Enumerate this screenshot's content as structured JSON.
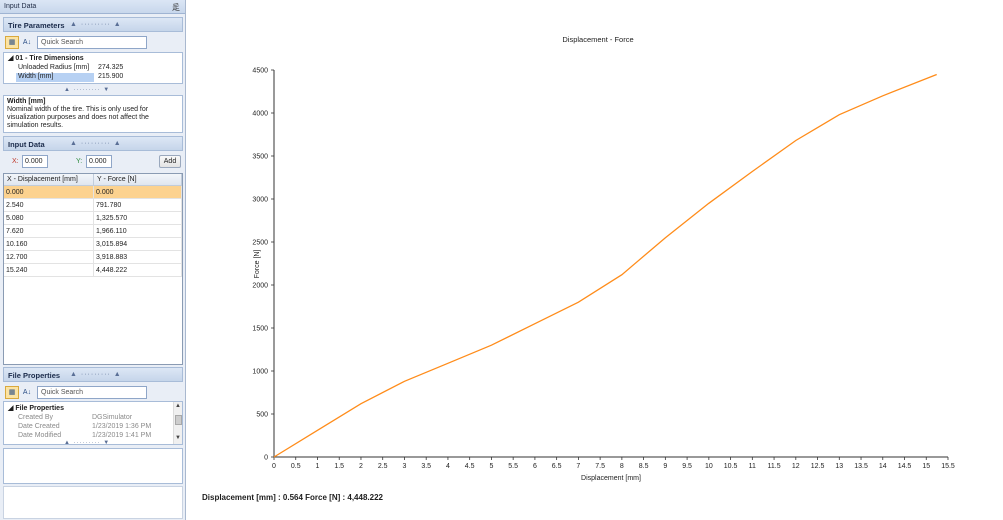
{
  "panel": {
    "title": "Input Data",
    "pin_glyph": "⾡"
  },
  "tire_parameters": {
    "header": "Tire Parameters",
    "search_placeholder": "Quick Search",
    "category": "01 - Tire Dimensions",
    "rows": [
      {
        "label": "Unloaded Radius [mm]",
        "value": "274.325"
      },
      {
        "label": "Width [mm]",
        "value": "215.900"
      }
    ]
  },
  "description": {
    "title": "Width [mm]",
    "text": "Nominal width of the tire. This is only used for visualization purposes and does not affect the simulation results."
  },
  "input_data": {
    "header": "Input Data",
    "x_label": "X:",
    "y_label": "Y:",
    "x_value": "0.000",
    "y_value": "0.000",
    "add_label": "Add",
    "columns": [
      "X - Displacement [mm]",
      "Y - Force [N]"
    ],
    "rows": [
      [
        "0.000",
        "0.000"
      ],
      [
        "2.540",
        "791.780"
      ],
      [
        "5.080",
        "1,325.570"
      ],
      [
        "7.620",
        "1,966.110"
      ],
      [
        "10.160",
        "3,015.894"
      ],
      [
        "12.700",
        "3,918.883"
      ],
      [
        "15.240",
        "4,448.222"
      ]
    ]
  },
  "file_properties": {
    "header": "File Properties",
    "search_placeholder": "Quick Search",
    "category": "File Properties",
    "rows": [
      {
        "label": "Created By",
        "value": "DGSimulator"
      },
      {
        "label": "Date Created",
        "value": "1/23/2019 1:36 PM"
      },
      {
        "label": "Date Modified",
        "value": "1/23/2019 1:41 PM"
      }
    ]
  },
  "readout": "Displacement [mm] : 0.564 Force [N] : 4,448.222",
  "colors": {
    "line": "#ff8c1a",
    "selected_row": "#fcd28f"
  },
  "chart_data": {
    "type": "line",
    "title": "Displacement - Force",
    "xlabel": "Displacement [mm]",
    "ylabel": "Force [N]",
    "xlim": [
      0,
      15.5
    ],
    "ylim": [
      0,
      4500
    ],
    "xticks": [
      "0",
      "0.5",
      "1",
      "1.5",
      "2",
      "2.5",
      "3",
      "3.5",
      "4",
      "4.5",
      "5",
      "5.5",
      "6",
      "6.5",
      "7",
      "7.5",
      "8",
      "8.5",
      "9",
      "9.5",
      "10",
      "10.5",
      "11",
      "11.5",
      "12",
      "12.5",
      "13",
      "13.5",
      "14",
      "14.5",
      "15",
      "15.5"
    ],
    "yticks": [
      "0",
      "500",
      "1000",
      "1500",
      "2000",
      "2500",
      "3000",
      "3500",
      "4000",
      "4500"
    ],
    "grid": false,
    "series": [
      {
        "x": [
          0,
          1,
          2,
          3,
          4,
          5,
          6,
          7,
          8,
          9,
          10,
          11,
          12,
          13,
          14,
          15.24
        ],
        "y": [
          0,
          310,
          620,
          880,
          1090,
          1300,
          1550,
          1800,
          2120,
          2550,
          2950,
          3320,
          3680,
          3980,
          4200,
          4448
        ]
      }
    ]
  }
}
